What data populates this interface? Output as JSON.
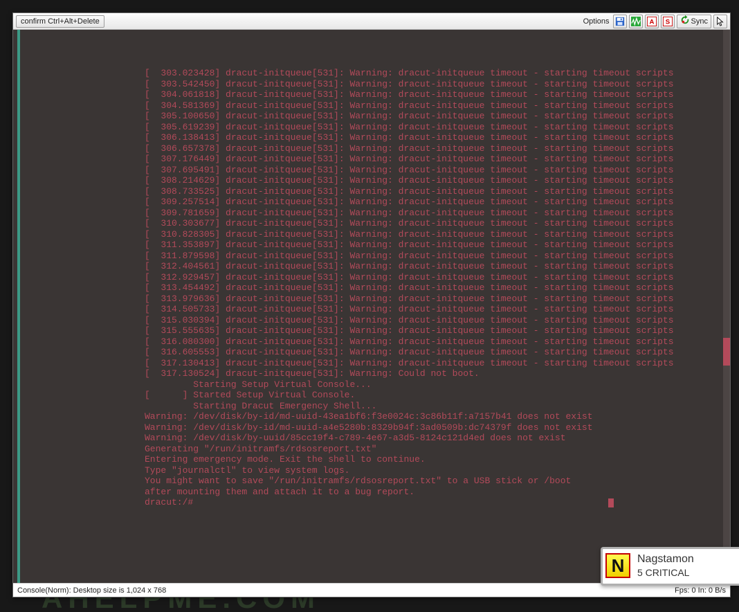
{
  "toolbar": {
    "confirm_label": "confirm Ctrl+Alt+Delete",
    "options_label": "Options",
    "sync_label": "Sync"
  },
  "icons": {
    "save": "save-icon",
    "activity": "activity-icon",
    "mark_a": "mark-a-icon",
    "mark_s": "mark-s-icon",
    "refresh": "refresh-icon",
    "cursor": "cursor-icon"
  },
  "statusbar": {
    "left": "Console(Norm): Desktop size is 1,024 x 768",
    "right": "Fps: 0 In: 0 B/s"
  },
  "nagstamon": {
    "letter": "N",
    "title": "Nagstamon",
    "critical": "5 CRITICAL"
  },
  "terminal": {
    "timeout_template_a": "[  ",
    "timeout_template_b": "] dracut-initqueue[531]: Warning: dracut-initqueue timeout - starting timeout scripts",
    "timestamps": [
      "303.023428",
      "303.542450",
      "304.061818",
      "304.581369",
      "305.100650",
      "305.619239",
      "306.138413",
      "306.657378",
      "307.176449",
      "307.695491",
      "308.214629",
      "308.733525",
      "309.257514",
      "309.781659",
      "310.303677",
      "310.828305",
      "311.353897",
      "311.879598",
      "312.404561",
      "312.929457",
      "313.454492",
      "313.979636",
      "314.505733",
      "315.030394",
      "315.555635",
      "316.080300",
      "316.605553",
      "317.130413"
    ],
    "post_lines": [
      "[  317.130524] dracut-initqueue[531]: Warning: Could not boot.",
      "         Starting Setup Virtual Console...",
      "[      ] Started Setup Virtual Console.",
      "         Starting Dracut Emergency Shell...",
      "Warning: /dev/disk/by-id/md-uuid-43ea1bf6:f3e0024c:3c86b11f:a7157b41 does not exist",
      "Warning: /dev/disk/by-id/md-uuid-a4e5280b:8329b94f:3ad0509b:dc74379f does not exist",
      "Warning: /dev/disk/by-uuid/85cc19f4-c789-4e67-a3d5-8124c121d4ed does not exist",
      "",
      "Generating \"/run/initramfs/rdsosreport.txt\"",
      "",
      "",
      "Entering emergency mode. Exit the shell to continue.",
      "Type \"journalctl\" to view system logs.",
      "You might want to save \"/run/initramfs/rdsosreport.txt\" to a USB stick or /boot",
      "after mounting them and attach it to a bug report.",
      "",
      "",
      "dracut:/#"
    ]
  },
  "watermark": "AHELPME.COM"
}
